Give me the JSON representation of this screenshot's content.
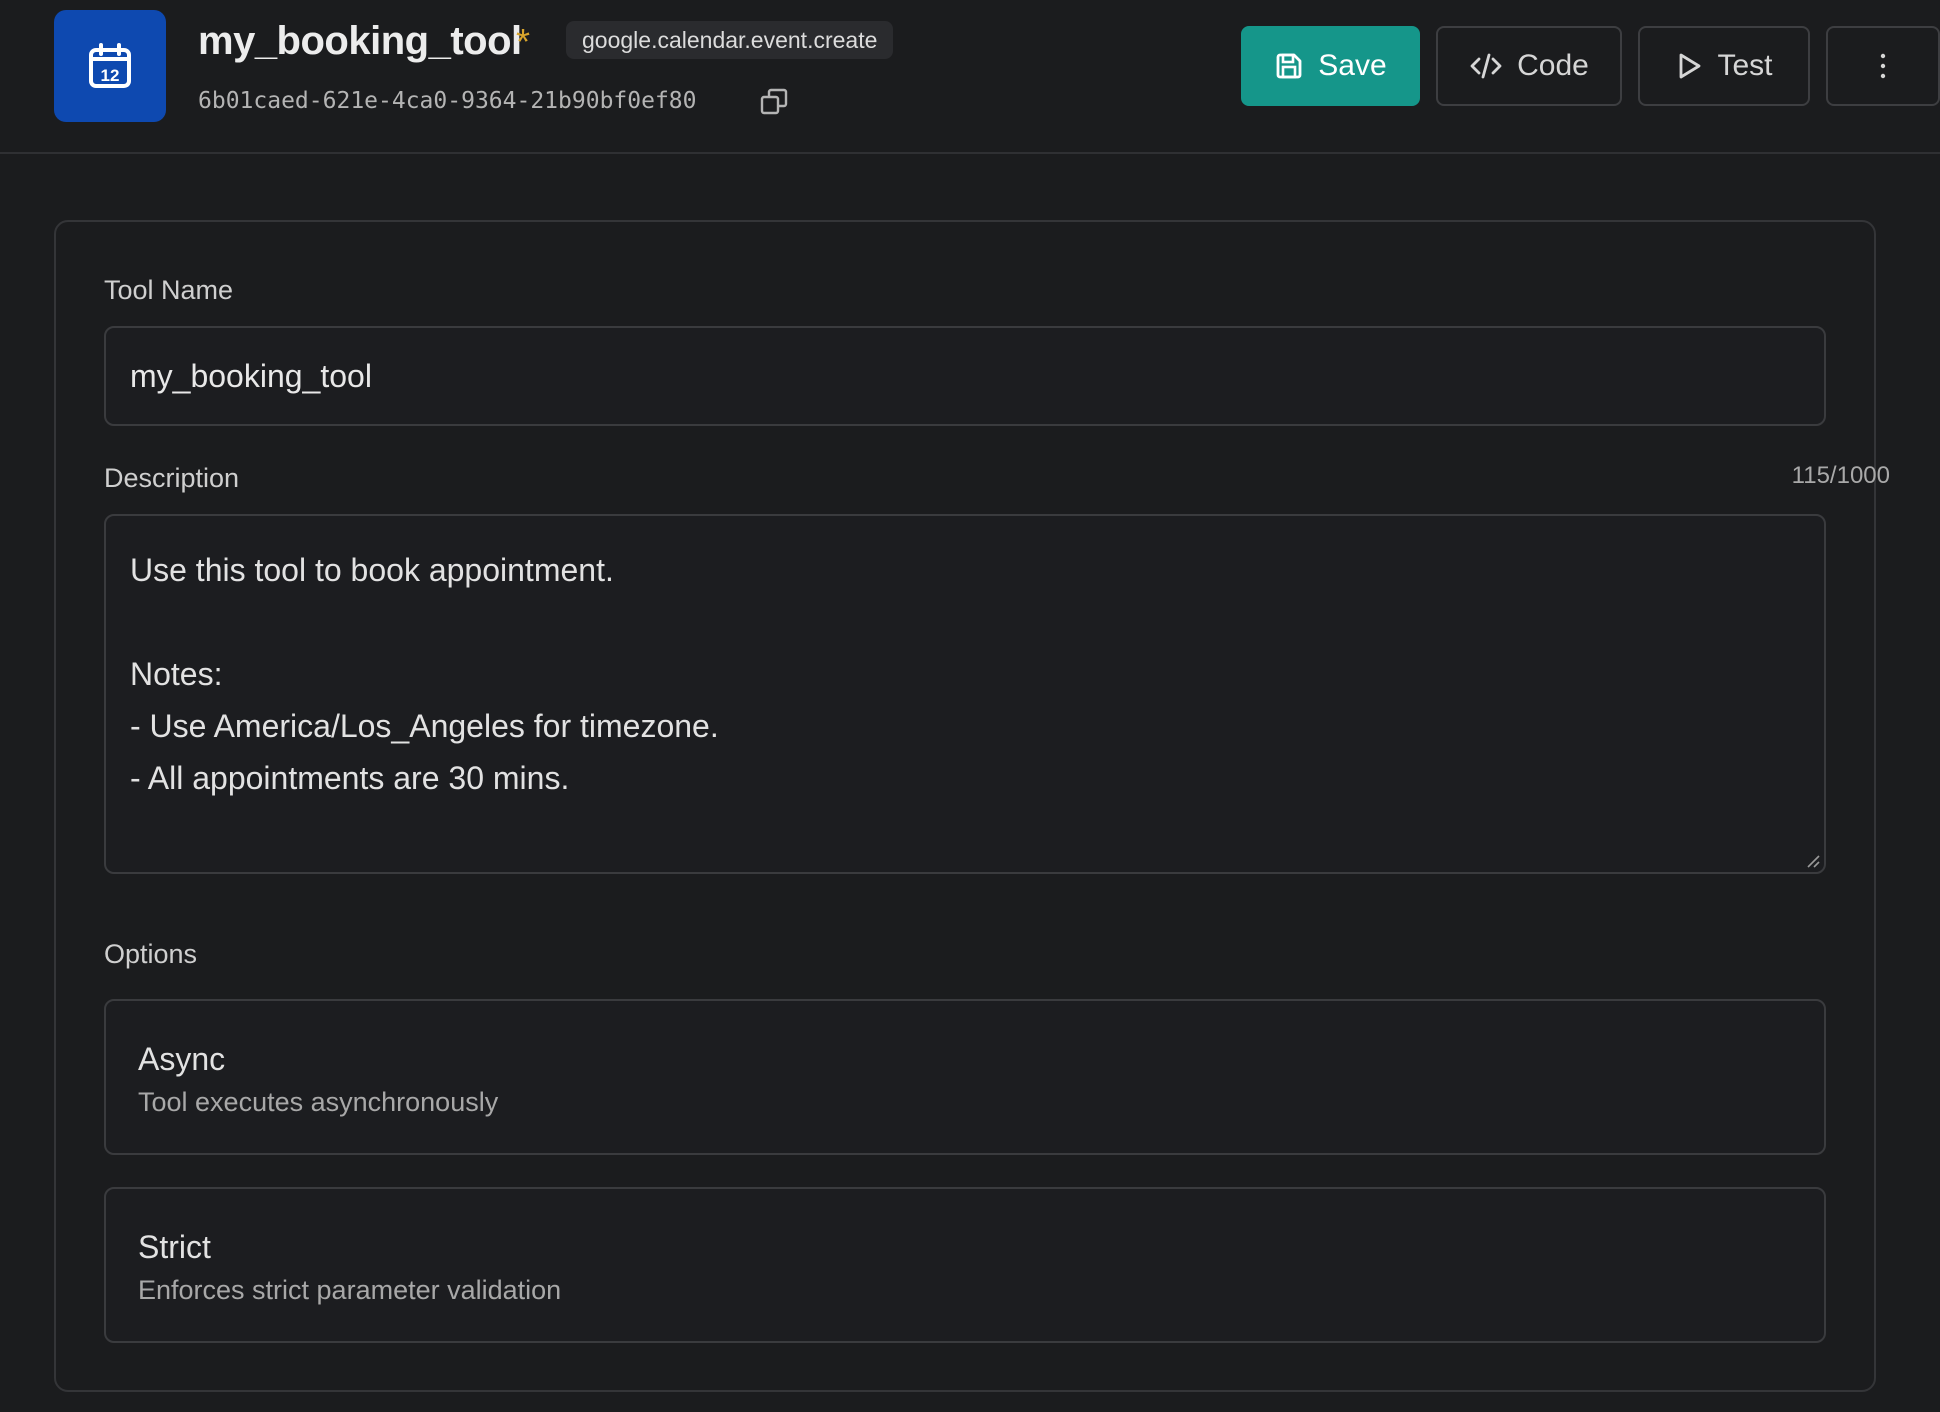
{
  "header": {
    "title": "my_booking_tool",
    "unsaved_marker": "*",
    "action_chip": "google.calendar.event.create",
    "tool_id": "6b01caed-621e-4ca0-9364-21b90bf0ef80",
    "app_icon": "calendar-icon",
    "app_icon_day": "12",
    "buttons": {
      "save": "Save",
      "code": "Code",
      "test": "Test"
    }
  },
  "form": {
    "tool_name_label": "Tool Name",
    "tool_name_value": "my_booking_tool",
    "description_label": "Description",
    "description_counter": "115/1000",
    "description_lines": [
      "Use this tool to book appointment.",
      "",
      "Notes:",
      "- Use America/Los_Angeles for timezone.",
      "- All appointments are 30 mins."
    ],
    "options_label": "Options",
    "options": [
      {
        "title": "Async",
        "description": "Tool executes asynchronously"
      },
      {
        "title": "Strict",
        "description": "Enforces strict parameter validation"
      }
    ]
  },
  "colors": {
    "background": "#1b1c1e",
    "app_icon_bg": "#0e49b0",
    "save_button": "#15968a",
    "unsaved_marker": "#d8a42c"
  }
}
